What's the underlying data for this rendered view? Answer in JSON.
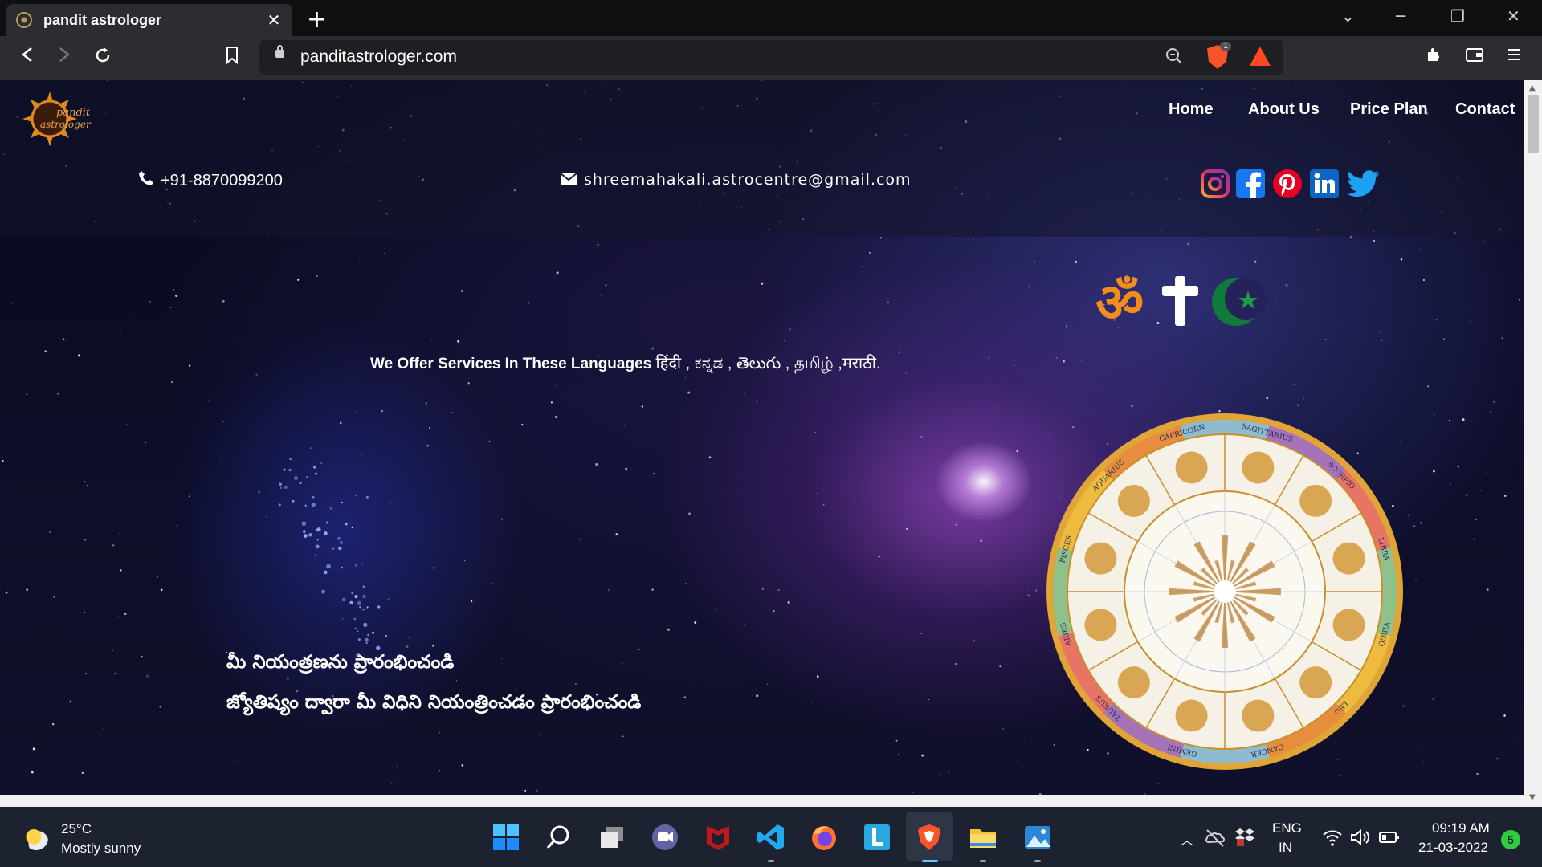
{
  "browser": {
    "tab_title": "pandit astrologer",
    "new_tab": "+",
    "url": "panditastrologer.com",
    "shield_count": "1"
  },
  "site": {
    "logo_line1": "pandit",
    "logo_line2": "astrologer",
    "nav": [
      "Home",
      "About Us",
      "Price Plan",
      "Contact"
    ],
    "phone": "+91-8870099200",
    "email": "shreemahakali.astrocentre@gmail.com",
    "social": [
      "instagram-icon",
      "facebook-icon",
      "pinterest-icon",
      "linkedin-icon",
      "twitter-icon"
    ],
    "languages_prefix": "We Offer Services In These Languages",
    "languages_native": "हिंदी , ಕನ್ನಡ , తెలుగు , தமிழ் ,मराठी.",
    "telugu_line1": "మీ నియంత్రణను ప్రారంభించండి",
    "telugu_line2": "జ్యోతిష్యం ద్వారా మీ విధిని నియంత్రించడం ప్రారంభించండి",
    "om_symbol": "ॐ",
    "zodiac": [
      "SAGITTARIUS",
      "SCORPIO",
      "LIBRA",
      "VIRGO",
      "LEO",
      "CANCER",
      "GEMINI",
      "TAURUS",
      "ARIES",
      "PISCES",
      "AQUARIUS",
      "CAPRICORN"
    ]
  },
  "taskbar": {
    "temp": "25°C",
    "weather": "Mostly sunny",
    "lang": "ENG",
    "region": "IN",
    "time": "09:19 AM",
    "date": "21-03-2022",
    "notification_count": "5"
  },
  "colors": {
    "accent": "#f28c1b",
    "brave": "#fb542b"
  }
}
